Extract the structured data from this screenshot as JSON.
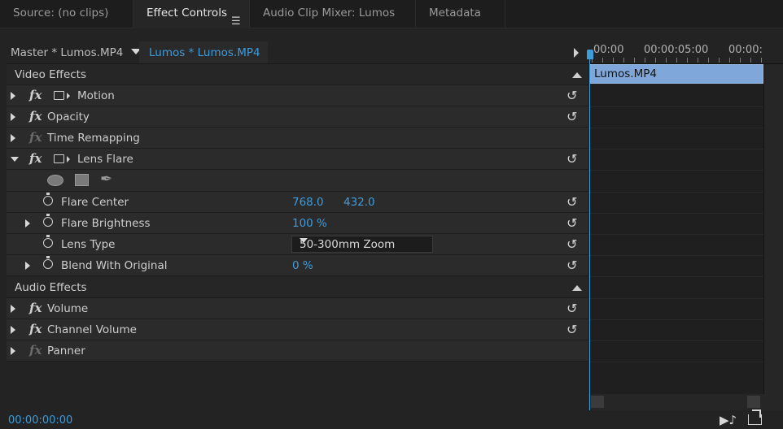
{
  "tabs": [
    {
      "label": "Source: (no clips)"
    },
    {
      "label": "Effect Controls"
    },
    {
      "label": "Audio Clip Mixer: Lumos"
    },
    {
      "label": "Metadata"
    }
  ],
  "effect_controls": {
    "master_label": "Master * Lumos.MP4",
    "clip_label": "Lumos * Lumos.MP4",
    "video_effects_label": "Video Effects",
    "audio_effects_label": "Audio Effects",
    "effects": {
      "motion": "Motion",
      "opacity": "Opacity",
      "time_remapping": "Time Remapping",
      "lens_flare": "Lens Flare",
      "volume": "Volume",
      "channel_volume": "Channel Volume",
      "panner": "Panner"
    },
    "params": {
      "flare_center": {
        "label": "Flare Center",
        "x": "768.0",
        "y": "432.0"
      },
      "flare_brightness": {
        "label": "Flare Brightness",
        "value": "100 %"
      },
      "lens_type": {
        "label": "Lens Type",
        "value": "50-300mm Zoom"
      },
      "blend_with_original": {
        "label": "Blend With Original",
        "value": "0 %"
      }
    },
    "fx_symbol": "fx"
  },
  "timeline": {
    "ticks": [
      "00:00",
      "00:00:05:00",
      "00:00:"
    ],
    "clip_name": "Lumos.MP4"
  },
  "bottom": {
    "timecode": "00:00:00:00"
  },
  "colors": {
    "accent": "#3f9cdb",
    "clip": "#7fa7d9"
  }
}
